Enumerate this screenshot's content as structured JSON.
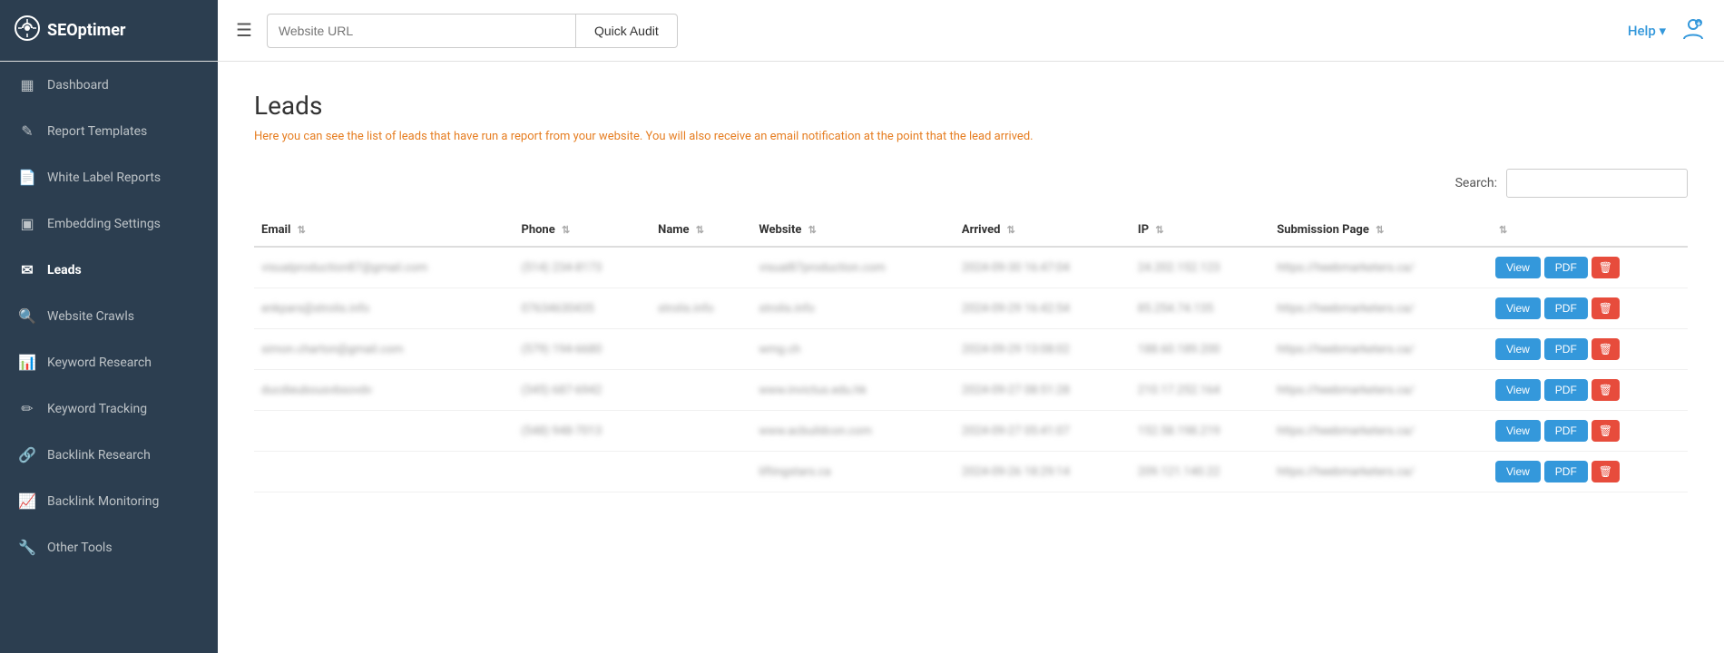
{
  "logo": {
    "icon": "⚙",
    "text": "SEOptimer"
  },
  "header": {
    "url_placeholder": "Website URL",
    "quick_audit_label": "Quick Audit",
    "help_label": "Help ▾",
    "hamburger_label": "☰"
  },
  "sidebar": {
    "items": [
      {
        "id": "dashboard",
        "label": "Dashboard",
        "icon": "▦"
      },
      {
        "id": "report-templates",
        "label": "Report Templates",
        "icon": "✎"
      },
      {
        "id": "white-label-reports",
        "label": "White Label Reports",
        "icon": "📄"
      },
      {
        "id": "embedding-settings",
        "label": "Embedding Settings",
        "icon": "▣"
      },
      {
        "id": "leads",
        "label": "Leads",
        "icon": "✉",
        "active": true
      },
      {
        "id": "website-crawls",
        "label": "Website Crawls",
        "icon": "🔍"
      },
      {
        "id": "keyword-research",
        "label": "Keyword Research",
        "icon": "📊"
      },
      {
        "id": "keyword-tracking",
        "label": "Keyword Tracking",
        "icon": "✏"
      },
      {
        "id": "backlink-research",
        "label": "Backlink Research",
        "icon": "🔗"
      },
      {
        "id": "backlink-monitoring",
        "label": "Backlink Monitoring",
        "icon": "📈"
      },
      {
        "id": "other-tools",
        "label": "Other Tools",
        "icon": "🔧"
      }
    ]
  },
  "page": {
    "title": "Leads",
    "description": "Here you can see the list of leads that have run a report from your website. You will also receive an email notification at the point that the lead arrived.",
    "search_label": "Search:",
    "search_placeholder": ""
  },
  "table": {
    "columns": [
      {
        "id": "email",
        "label": "Email"
      },
      {
        "id": "phone",
        "label": "Phone"
      },
      {
        "id": "name",
        "label": "Name"
      },
      {
        "id": "website",
        "label": "Website"
      },
      {
        "id": "arrived",
        "label": "Arrived"
      },
      {
        "id": "ip",
        "label": "IP"
      },
      {
        "id": "submission_page",
        "label": "Submission Page"
      },
      {
        "id": "actions",
        "label": ""
      }
    ],
    "rows": [
      {
        "email": "visualproduction87@gmail.com",
        "phone": "(514) 234-8173",
        "name": "",
        "website": "visual87production.com",
        "arrived": "2024-09-30 16:47:04",
        "ip": "24.202.152.123",
        "submission_page": "https://heebmarketers.ca/"
      },
      {
        "email": "enkpars@strolis.info",
        "phone": "07634630435",
        "name": "strolis.info",
        "website": "strolis.info",
        "arrived": "2024-09-29 16:42:54",
        "ip": "85.254.74.135",
        "submission_page": "https://heebmarketers.ca/"
      },
      {
        "email": "simon.charton@gmail.com",
        "phone": "(579) 194-6680",
        "name": "",
        "website": "wmg.ch",
        "arrived": "2024-09-29 13:08:02",
        "ip": "188.60.189.200",
        "submission_page": "https://heebmarketers.ca/"
      },
      {
        "email": "ducdieubousvbsovdv",
        "phone": "(345) 687-6942",
        "name": "",
        "website": "www.invictus.edu.hk",
        "arrived": "2024-09-27 08:51:28",
        "ip": "210.17.252.164",
        "submission_page": "https://heebmarketers.ca/"
      },
      {
        "email": "",
        "phone": "(548) 948-7013",
        "name": "",
        "website": "www.acbuildcon.com",
        "arrived": "2024-09-27 05:41:07",
        "ip": "152.58.198.219",
        "submission_page": "https://heebmarketers.ca/"
      },
      {
        "email": "",
        "phone": "",
        "name": "",
        "website": "liftingstars.ca",
        "arrived": "2024-09-26 18:29:14",
        "ip": "209.121.140.22",
        "submission_page": "https://heebmarketers.ca/"
      }
    ],
    "btn_view": "View",
    "btn_pdf": "PDF",
    "btn_delete": "🗑"
  }
}
